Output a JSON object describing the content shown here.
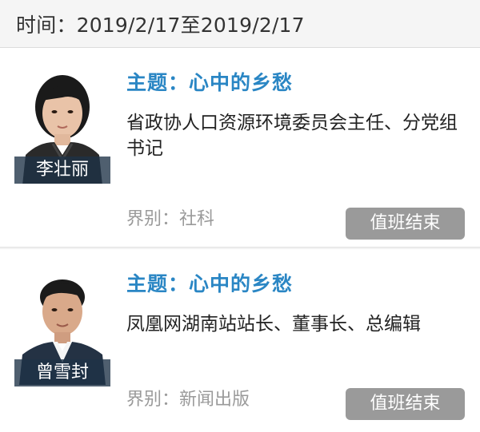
{
  "time_range": "时间：2019/2/17至2019/2/17",
  "entries": [
    {
      "name": "李壮丽",
      "topic": "主题：心中的乡愁",
      "position_text": "省政协人口资源环境委员会主任、分党组书记",
      "sector": "界别：社科",
      "button": "值班结束"
    },
    {
      "name": "曾雪封",
      "topic": "主题：心中的乡愁",
      "position_text": "凤凰网湖南站站长、董事长、总编辑",
      "sector": "界别：新闻出版",
      "button": "值班结束"
    }
  ],
  "colors": {
    "topic": "#2a86c4",
    "button_bg": "#9a9a9a",
    "name_plate": "#1e3246"
  }
}
